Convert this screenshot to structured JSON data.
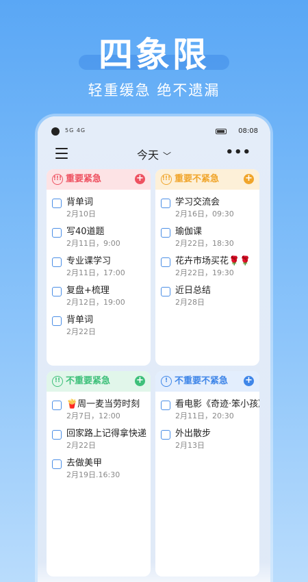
{
  "hero": {
    "title": "四象限",
    "subtitle": "轻重缓急 绝不遗漏"
  },
  "status_bar": {
    "signals": "5G 4G",
    "time": "08:08"
  },
  "app_bar": {
    "title": "今天",
    "menu_icon": "hamburger-icon",
    "more_icon": "more-horizontal-icon",
    "more_label": "•••"
  },
  "colors": {
    "important_urgent": "#ee5261",
    "important_not_urgent": "#f0a52b",
    "not_important_urgent": "#3ec07a",
    "not_important_not_urgent": "#3f86e8"
  },
  "quadrants": {
    "tl": {
      "label": "重要紧急",
      "icon": "!!!",
      "add": "+",
      "items": [
        {
          "title": "背单词",
          "date": "2月10日"
        },
        {
          "title": "写40道题",
          "date": "2月11日，9:00"
        },
        {
          "title": "专业课学习",
          "date": "2月11日，17:00"
        },
        {
          "title": "复盘+梳理",
          "date": "2月12日，19:00"
        },
        {
          "title": "背单词",
          "date": "2月22日"
        }
      ]
    },
    "tr": {
      "label": "重要不紧急",
      "icon": "!!!",
      "add": "+",
      "items": [
        {
          "title": "学习交流会",
          "date": "2月16日，09:30"
        },
        {
          "title": "瑜伽课",
          "date": "2月22日，18:30"
        },
        {
          "title": "花卉市场买花🌹🌹",
          "date": "2月22日，19:30"
        },
        {
          "title": "近日总结",
          "date": "2月28日"
        }
      ]
    },
    "bl": {
      "label": "不重要紧急",
      "icon": "!!",
      "add": "+",
      "items": [
        {
          "title": "🍟周一麦当劳时刻",
          "date": "2月7日，12:00"
        },
        {
          "title": "回家路上记得拿快递",
          "date": "2月22日"
        },
        {
          "title": "去做美甲",
          "date": "2月19日.16:30"
        }
      ]
    },
    "br": {
      "label": "不重要不紧急",
      "icon": "!",
      "add": "+",
      "items": [
        {
          "title": "看电影《奇迹·笨小孩》",
          "date": "2月11日，20:30"
        },
        {
          "title": "外出散步",
          "date": "2月13日"
        }
      ]
    }
  }
}
